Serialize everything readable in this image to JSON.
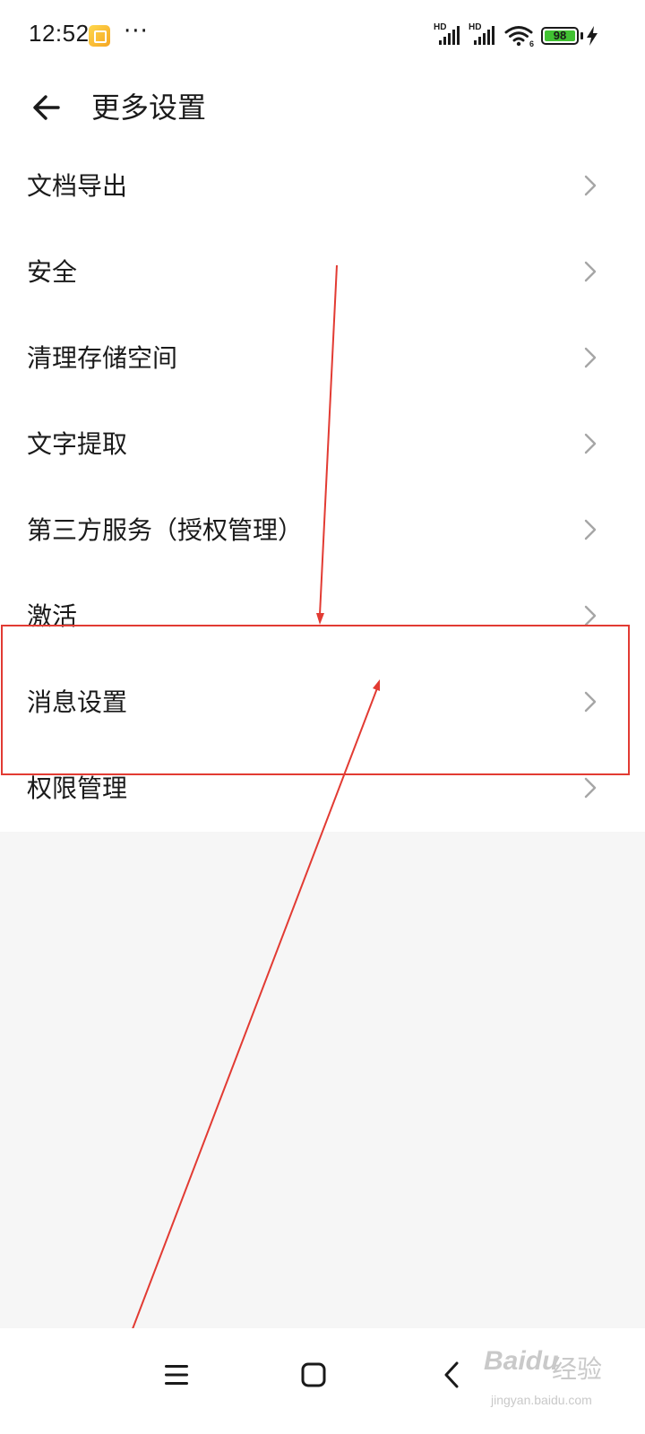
{
  "status_bar": {
    "time": "12:52",
    "more_indicator": "···",
    "signal_1_label": "HD",
    "signal_2_label": "HD",
    "wifi_badge": "6",
    "battery_level": "98",
    "notification_icon": "gallery-notification-icon",
    "battery_color": "#41c232"
  },
  "header": {
    "back_icon": "arrow-left-icon",
    "title": "更多设置"
  },
  "settings": {
    "items": [
      {
        "label": "文档导出"
      },
      {
        "label": "安全"
      },
      {
        "label": "清理存储空间"
      },
      {
        "label": "文字提取"
      },
      {
        "label": "第三方服务（授权管理）"
      },
      {
        "label": "激活"
      },
      {
        "label": "消息设置"
      },
      {
        "label": "权限管理"
      }
    ],
    "chevron_icon": "chevron-right-icon"
  },
  "annotation": {
    "color": "#e23b33",
    "highlighted_item": "消息设置"
  },
  "nav_bar": {
    "menu_icon": "menu-icon",
    "home_icon": "home-square-icon",
    "back_icon": "back-chevron-icon"
  },
  "watermark": {
    "brand": "Baidu",
    "text": "经验",
    "url": "jingyan.baidu.com"
  }
}
